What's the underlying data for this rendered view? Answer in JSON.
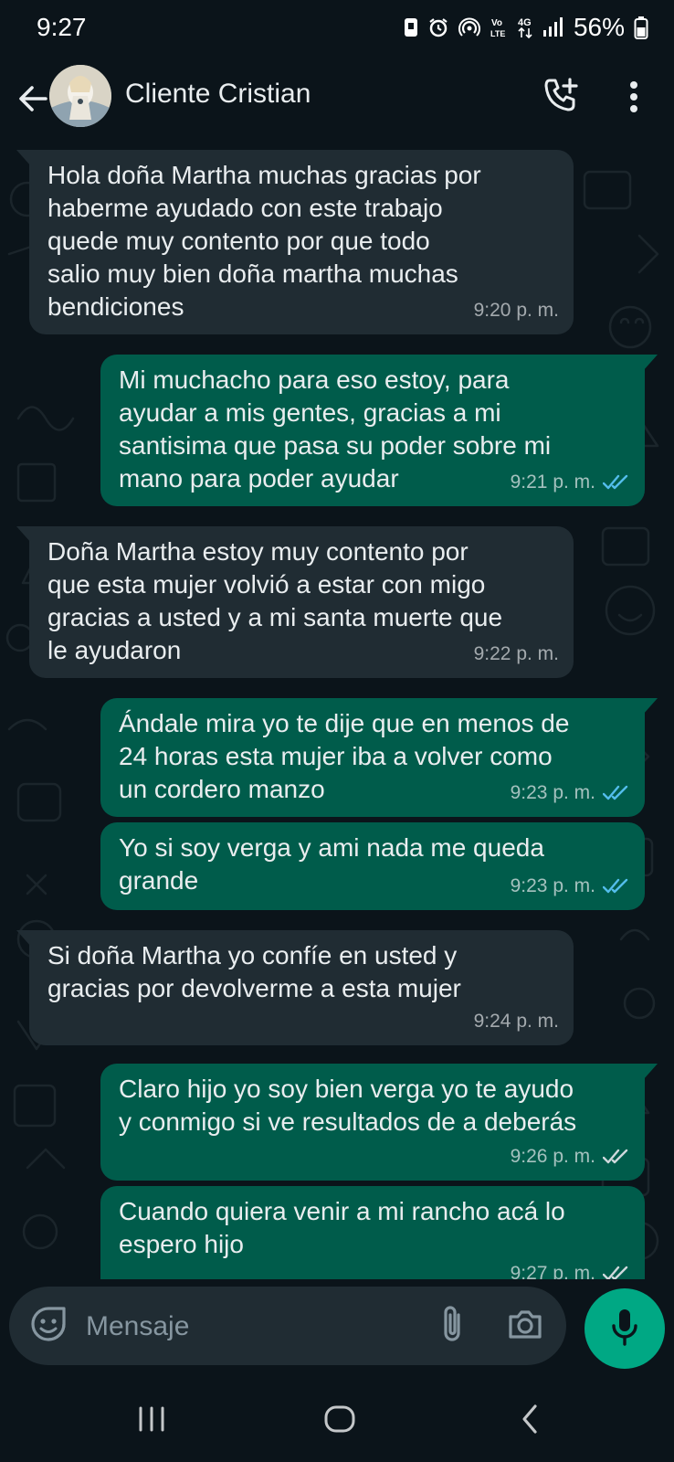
{
  "status_bar": {
    "time": "9:27",
    "battery_text": "56%",
    "network_label_1": "Vo\nLTE",
    "network_label_2": "4G"
  },
  "header": {
    "contact_name": "Cliente Cristian"
  },
  "messages": [
    {
      "direction": "in",
      "text": "Hola doña Martha muchas gracias por\nhaberme ayudado con este trabajo\nquede muy contento por que todo\nsalio muy bien doña martha muchas\nbendiciones",
      "time": "9:20 p. m."
    },
    {
      "direction": "out",
      "text": "Mi muchacho para eso estoy, para\nayudar a mis gentes, gracias a mi\nsantisima que pasa su poder sobre mi\nmano para poder ayudar",
      "time": "9:21 p. m.",
      "status": "read"
    },
    {
      "direction": "in",
      "text": "Doña Martha estoy muy contento por\nque esta mujer volvió a estar con migo\ngracias a usted y a mi santa muerte que\nle ayudaron",
      "time": "9:22 p. m."
    },
    {
      "direction": "out",
      "text": "Ándale mira yo te dije que en menos de\n24 horas esta mujer iba a volver como\nun cordero manzo",
      "time": "9:23 p. m.",
      "status": "read"
    },
    {
      "direction": "out",
      "text": "Yo si soy verga y ami nada me queda\ngrande",
      "time": "9:23 p. m.",
      "status": "read"
    },
    {
      "direction": "in",
      "text": "Si doña Martha yo confíe en usted y\ngracias por devolverme a esta mujer",
      "time": "9:24 p. m."
    },
    {
      "direction": "out",
      "text": "Claro hijo yo soy bien verga yo te ayudo\ny conmigo si ve resultados de a deberás",
      "time": "9:26 p. m.",
      "status": "delivered"
    },
    {
      "direction": "out",
      "text": "Cuando quiera venir a mi rancho acá lo\nespero hijo",
      "time": "9:27 p. m.",
      "status": "delivered"
    }
  ],
  "input": {
    "placeholder": "Mensaje"
  },
  "colors": {
    "background": "#0b141a",
    "incoming_bubble": "#202c33",
    "outgoing_bubble": "#005c4b",
    "read_tick": "#53bdeb",
    "delivered_tick": "#cfd8dc",
    "mic_button": "#00a884"
  },
  "icons": {
    "back": "arrow-left-icon",
    "call_add": "phone-plus-icon",
    "menu": "vertical-dots-icon",
    "emoji": "sticker-emoji-icon",
    "attach": "paperclip-icon",
    "camera": "camera-icon",
    "mic": "microphone-icon"
  }
}
